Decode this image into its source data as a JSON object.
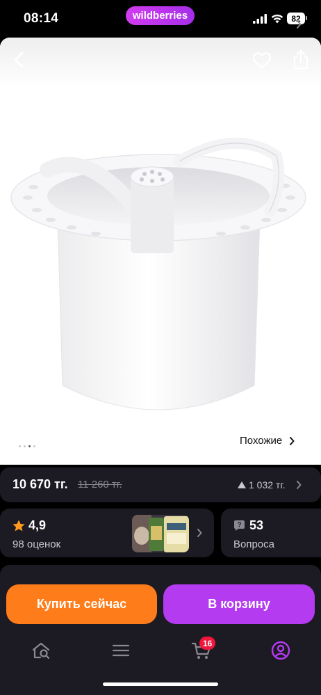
{
  "status_bar": {
    "time": "08:14",
    "battery": "82"
  },
  "brand": {
    "name": "wildberries"
  },
  "gallery": {
    "similar_label": "Похожие",
    "dots_count": 4,
    "active_dot": 2
  },
  "price": {
    "current": "10 670 тг.",
    "old": "11 260 тг.",
    "change": "1 032 тг."
  },
  "rating": {
    "value": "4,9",
    "count_label": "98 оценок"
  },
  "questions": {
    "count": "53",
    "label": "Вопроса"
  },
  "actions": {
    "buy_now": "Купить сейчас",
    "add_to_cart": "В корзину"
  },
  "nav": {
    "cart_badge": "16"
  },
  "colors": {
    "brand_gradient_start": "#d23cf0",
    "buy_now": "#ff7c1a",
    "add_to_cart": "#b43bf0",
    "cart_badge": "#f0163b",
    "card_bg": "#1c1a22",
    "star": "#ff9a1f",
    "profile_icon": "#b43bf0"
  },
  "icons": [
    "back-icon",
    "heart-icon",
    "share-icon",
    "star-icon",
    "question-icon",
    "home-icon",
    "catalog-icon",
    "cart-icon",
    "profile-icon"
  ]
}
